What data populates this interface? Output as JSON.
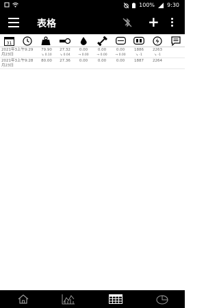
{
  "status": {
    "battery": "100%",
    "time": "9:30"
  },
  "appbar": {
    "title": "表格"
  },
  "rows": [
    {
      "time": "2021年3上午9:29\n月23日",
      "v1": "79.90",
      "d1": "0.10",
      "d1_dir": "up",
      "v2": "27.32",
      "d2": "0.04",
      "d2_dir": "up",
      "v3": "0.00",
      "d3": "0.00",
      "v4": "0.00",
      "d4": "0.00",
      "v5": "0.00",
      "d5": "0.00",
      "v6": "1886",
      "d6": "-1",
      "v7": "2263",
      "d7": "-1"
    },
    {
      "time": "2021年3上午9:28\n月23日",
      "v1": "80.00",
      "v2": "27.36",
      "v3": "0.00",
      "v4": "0.00",
      "v5": "0.00",
      "v6": "1887",
      "v7": "2264"
    }
  ],
  "colors": {
    "bar": "#000000",
    "up": "#2a9d2a",
    "down": "#d32f2f"
  }
}
